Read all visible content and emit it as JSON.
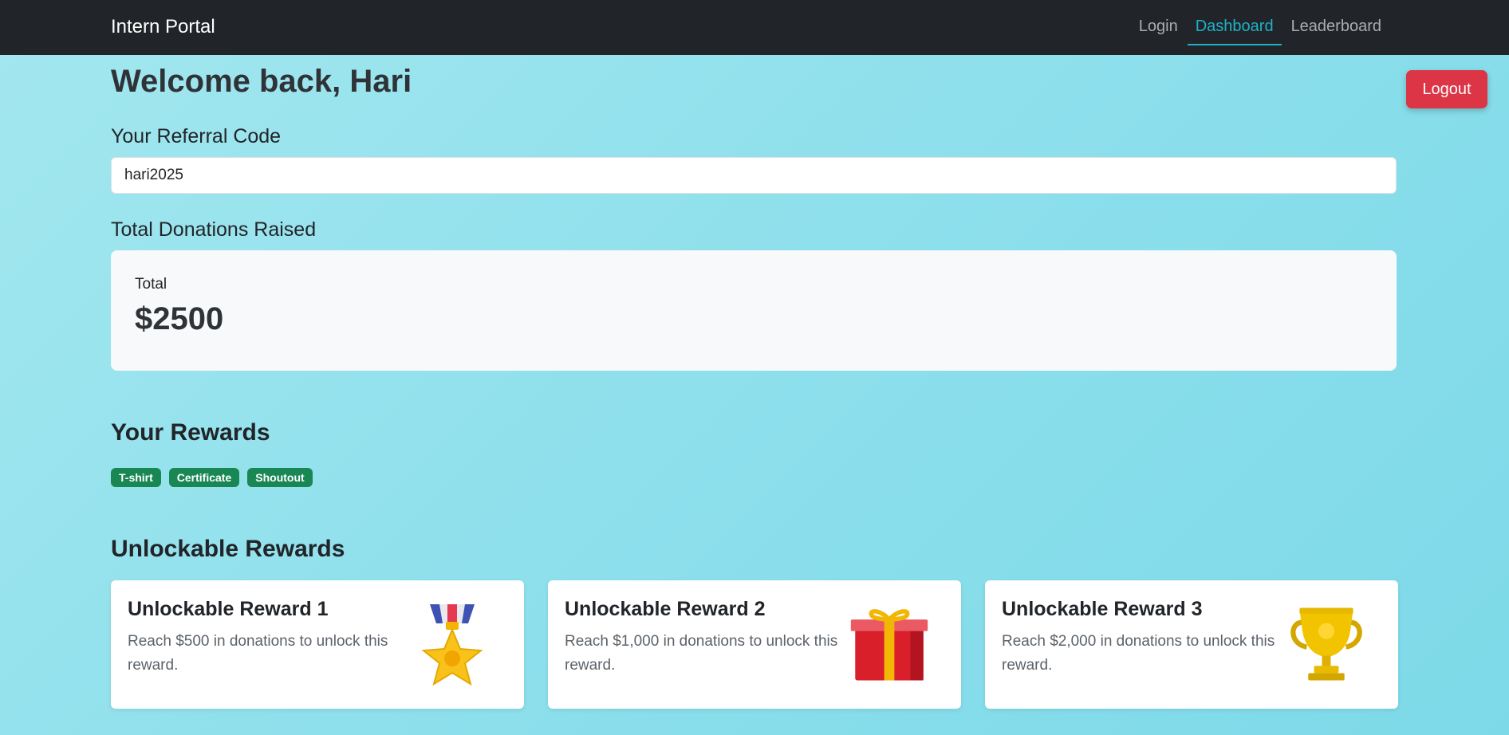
{
  "nav": {
    "brand": "Intern Portal",
    "links": [
      {
        "label": "Login",
        "active": false
      },
      {
        "label": "Dashboard",
        "active": true
      },
      {
        "label": "Leaderboard",
        "active": false
      }
    ]
  },
  "logout_label": "Logout",
  "welcome": "Welcome back, Hari",
  "referral": {
    "label": "Your Referral Code",
    "value": "hari2025"
  },
  "donations": {
    "label": "Total Donations Raised",
    "total_label": "Total",
    "total_value": "$2500"
  },
  "rewards": {
    "title": "Your Rewards",
    "badges": [
      "T-shirt",
      "Certificate",
      "Shoutout"
    ]
  },
  "unlockables": {
    "title": "Unlockable Rewards",
    "cards": [
      {
        "title": "Unlockable Reward 1",
        "text": "Reach $500 in donations to unlock this reward.",
        "icon": "medal-icon"
      },
      {
        "title": "Unlockable Reward 2",
        "text": "Reach $1,000 in donations to unlock this reward.",
        "icon": "gift-icon"
      },
      {
        "title": "Unlockable Reward 3",
        "text": "Reach $2,000 in donations to unlock this reward.",
        "icon": "trophy-icon"
      }
    ]
  },
  "colors": {
    "navbar": "#212529",
    "accent": "#1fb0c6",
    "logout": "#dc3545",
    "badge": "#198754"
  }
}
